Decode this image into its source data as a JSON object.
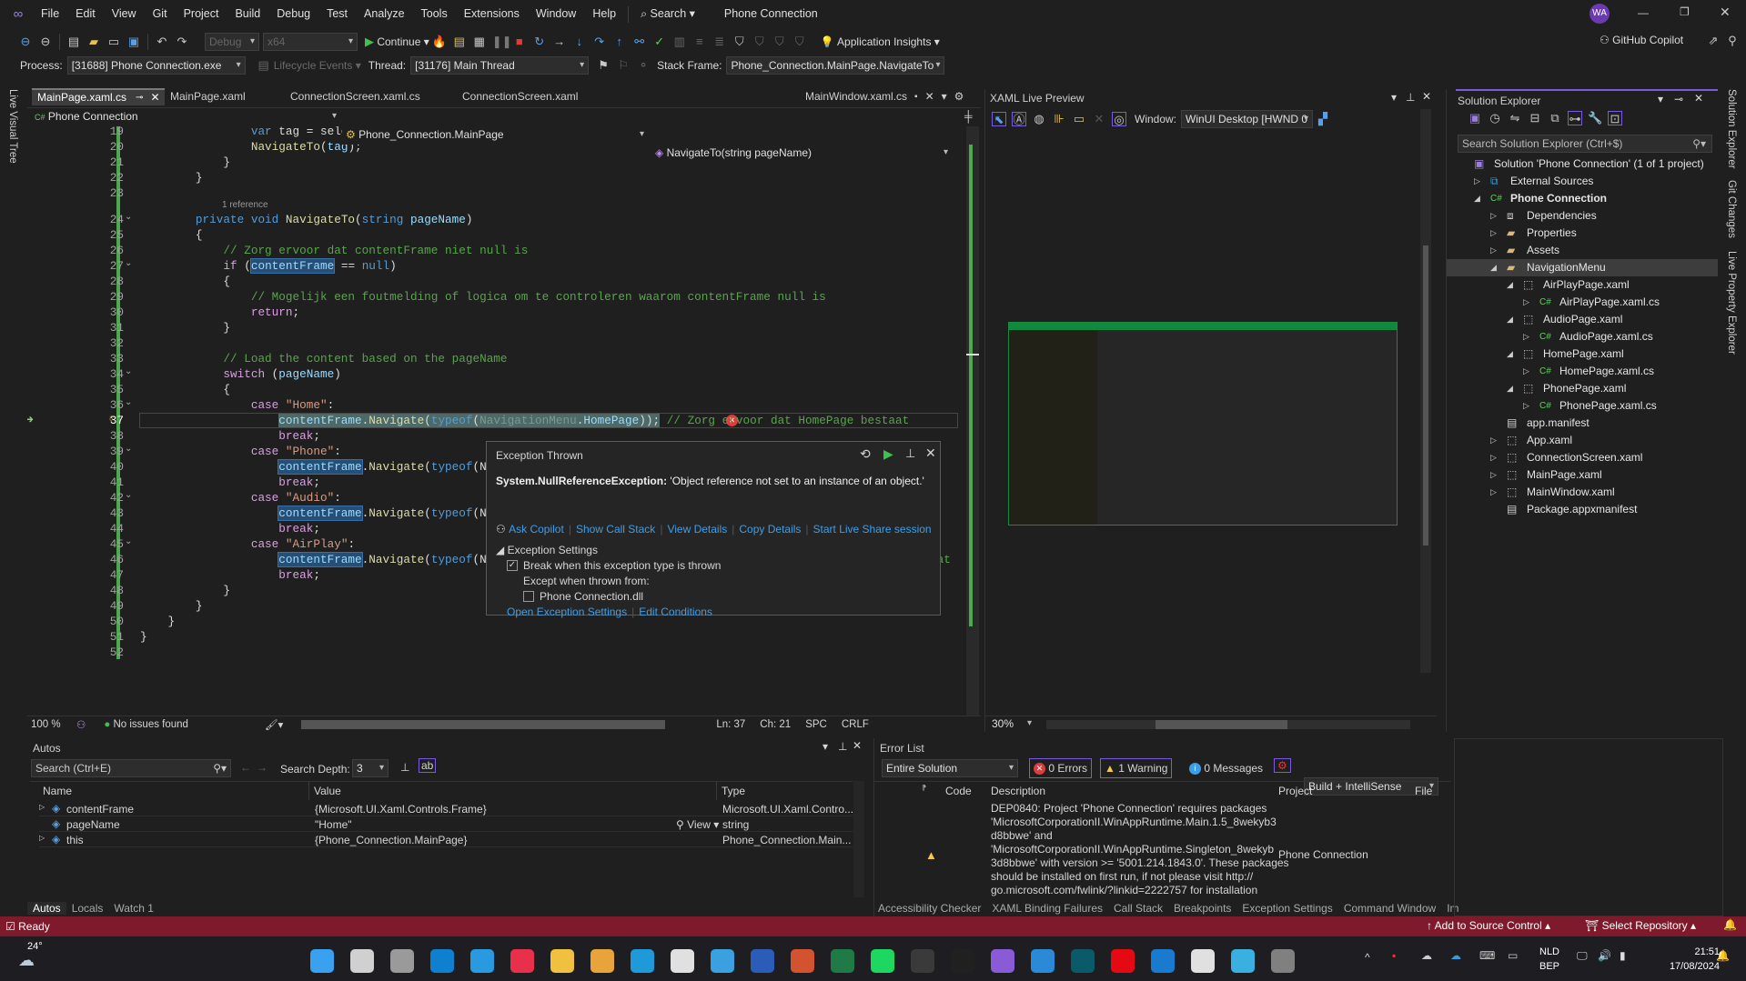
{
  "menubar": {
    "items": [
      "File",
      "Edit",
      "View",
      "Git",
      "Project",
      "Build",
      "Debug",
      "Test",
      "Analyze",
      "Tools",
      "Extensions",
      "Window",
      "Help"
    ],
    "search": "Search",
    "solution_name": "Phone Connection",
    "avatar": "WA"
  },
  "toolbar": {
    "config": "Debug",
    "platform": "x64",
    "continue": "Continue",
    "app_insights": "Application Insights",
    "copilot": "GitHub Copilot"
  },
  "debugbar": {
    "process_label": "Process:",
    "process": "[31688] Phone Connection.exe",
    "lifecycle": "Lifecycle Events",
    "thread_label": "Thread:",
    "thread": "[31176] Main Thread",
    "stack_label": "Stack Frame:",
    "stack": "Phone_Connection.MainPage.NavigateTo"
  },
  "left_strip": "Live Visual Tree",
  "right_strip": [
    "Solution Explorer",
    "Git Changes",
    "Live Property Explorer"
  ],
  "editor": {
    "tabs": [
      "MainPage.xaml.cs",
      "MainPage.xaml",
      "ConnectionScreen.xaml.cs",
      "ConnectionScreen.xaml"
    ],
    "right_tab": "MainWindow.xaml.cs",
    "nav": {
      "project": "Phone Connection",
      "class": "Phone_Connection.MainPage",
      "member": "NavigateTo(string pageName)"
    },
    "codelens": "1 reference",
    "current_line": 37,
    "lines": [
      {
        "n": 19,
        "seg": [
          [
            "d",
            "                "
          ],
          [
            "k",
            "var"
          ],
          [
            "d",
            " tag = selectedItem.Tag.ToString();"
          ]
        ]
      },
      {
        "n": 20,
        "seg": [
          [
            "d",
            "                "
          ],
          [
            "m",
            "NavigateTo"
          ],
          [
            "d",
            "("
          ],
          [
            "p",
            "tag"
          ],
          [
            "d",
            ");"
          ]
        ]
      },
      {
        "n": 21,
        "seg": [
          [
            "d",
            "            }"
          ]
        ]
      },
      {
        "n": 22,
        "seg": [
          [
            "d",
            "        }"
          ]
        ]
      },
      {
        "n": 23,
        "seg": []
      },
      {
        "n": 24,
        "seg": [
          [
            "d",
            "        "
          ],
          [
            "k",
            "private void "
          ],
          [
            "m",
            "NavigateTo"
          ],
          [
            "d",
            "("
          ],
          [
            "k",
            "string "
          ],
          [
            "p",
            "pageName"
          ],
          [
            "d",
            ")"
          ]
        ]
      },
      {
        "n": 25,
        "seg": [
          [
            "d",
            "        {"
          ]
        ]
      },
      {
        "n": 26,
        "seg": [
          [
            "d",
            "            "
          ],
          [
            "g",
            "// Zorg ervoor dat contentFrame niet null is"
          ]
        ]
      },
      {
        "n": 27,
        "seg": [
          [
            "d",
            "            "
          ],
          [
            "c",
            "if"
          ],
          [
            "d",
            " ("
          ],
          [
            "h",
            "contentFrame"
          ],
          [
            "d",
            " == "
          ],
          [
            "k",
            "null"
          ],
          [
            "d",
            ")"
          ]
        ]
      },
      {
        "n": 28,
        "seg": [
          [
            "d",
            "            {"
          ]
        ]
      },
      {
        "n": 29,
        "seg": [
          [
            "d",
            "                "
          ],
          [
            "g",
            "// Mogelijk een foutmelding of logica om te controleren waarom contentFrame null is"
          ]
        ]
      },
      {
        "n": 30,
        "seg": [
          [
            "d",
            "                "
          ],
          [
            "c",
            "return"
          ],
          [
            "d",
            ";"
          ]
        ]
      },
      {
        "n": 31,
        "seg": [
          [
            "d",
            "            }"
          ]
        ]
      },
      {
        "n": 32,
        "seg": []
      },
      {
        "n": 33,
        "seg": [
          [
            "d",
            "            "
          ],
          [
            "g",
            "// Load the content based on the pageName"
          ]
        ]
      },
      {
        "n": 34,
        "seg": [
          [
            "d",
            "            "
          ],
          [
            "c",
            "switch"
          ],
          [
            "d",
            " ("
          ],
          [
            "p",
            "pageName"
          ],
          [
            "d",
            ")"
          ]
        ]
      },
      {
        "n": 35,
        "seg": [
          [
            "d",
            "            {"
          ]
        ]
      },
      {
        "n": 36,
        "seg": [
          [
            "d",
            "                "
          ],
          [
            "c",
            "case "
          ],
          [
            "s",
            "\"Home\""
          ],
          [
            "d",
            ":"
          ]
        ]
      },
      {
        "n": 37,
        "seg": [
          [
            "d",
            "                    "
          ],
          [
            "p",
            "contentFrame"
          ],
          [
            "d",
            "."
          ],
          [
            "m",
            "Navigate"
          ],
          [
            "d",
            "("
          ],
          [
            "k",
            "typeof"
          ],
          [
            "d",
            "("
          ],
          [
            "t",
            "NavigationMenu"
          ],
          [
            "d",
            "."
          ],
          [
            "p",
            "HomePage"
          ],
          [
            "d",
            "));"
          ],
          [
            "d",
            " "
          ],
          [
            "g",
            "// Zorg ervoor dat HomePage bestaat"
          ]
        ]
      },
      {
        "n": 38,
        "seg": [
          [
            "d",
            "                    "
          ],
          [
            "c",
            "break"
          ],
          [
            "d",
            ";"
          ]
        ]
      },
      {
        "n": 39,
        "seg": [
          [
            "d",
            "                "
          ],
          [
            "c",
            "case "
          ],
          [
            "s",
            "\"Phone\""
          ],
          [
            "d",
            ":"
          ]
        ]
      },
      {
        "n": 40,
        "seg": [
          [
            "d",
            "                    "
          ],
          [
            "h",
            "contentFrame"
          ],
          [
            "d",
            "."
          ],
          [
            "m",
            "Navigate"
          ],
          [
            "d",
            "("
          ],
          [
            "k",
            "typeof"
          ],
          [
            "d",
            "(N"
          ]
        ]
      },
      {
        "n": 41,
        "seg": [
          [
            "d",
            "                    "
          ],
          [
            "c",
            "break"
          ],
          [
            "d",
            ";"
          ]
        ]
      },
      {
        "n": 42,
        "seg": [
          [
            "d",
            "                "
          ],
          [
            "c",
            "case "
          ],
          [
            "s",
            "\"Audio\""
          ],
          [
            "d",
            ":"
          ]
        ]
      },
      {
        "n": 43,
        "seg": [
          [
            "d",
            "                    "
          ],
          [
            "h",
            "contentFrame"
          ],
          [
            "d",
            "."
          ],
          [
            "m",
            "Navigate"
          ],
          [
            "d",
            "("
          ],
          [
            "k",
            "typeof"
          ],
          [
            "d",
            "(N"
          ]
        ]
      },
      {
        "n": 44,
        "seg": [
          [
            "d",
            "                    "
          ],
          [
            "c",
            "break"
          ],
          [
            "d",
            ";"
          ]
        ]
      },
      {
        "n": 45,
        "seg": [
          [
            "d",
            "                "
          ],
          [
            "c",
            "case "
          ],
          [
            "s",
            "\"AirPlay\""
          ],
          [
            "d",
            ":"
          ]
        ]
      },
      {
        "n": 46,
        "seg": [
          [
            "d",
            "                    "
          ],
          [
            "h",
            "contentFrame"
          ],
          [
            "d",
            "."
          ],
          [
            "m",
            "Navigate"
          ],
          [
            "d",
            "("
          ],
          [
            "k",
            "typeof"
          ],
          [
            "d",
            "(NavigationMenu.AirPlayPage)); "
          ],
          [
            "g",
            "// Zorg ervoor dat AirPlayPage bestaat"
          ]
        ]
      },
      {
        "n": 47,
        "seg": [
          [
            "d",
            "                    "
          ],
          [
            "c",
            "break"
          ],
          [
            "d",
            ";"
          ]
        ]
      },
      {
        "n": 48,
        "seg": [
          [
            "d",
            "            }"
          ]
        ]
      },
      {
        "n": 49,
        "seg": [
          [
            "d",
            "        }"
          ]
        ]
      },
      {
        "n": 50,
        "seg": [
          [
            "d",
            "    }"
          ]
        ]
      },
      {
        "n": 51,
        "seg": [
          [
            "d",
            "}"
          ]
        ]
      },
      {
        "n": 52,
        "seg": []
      }
    ],
    "status": {
      "zoom": "100 %",
      "issues": "No issues found",
      "ln": "Ln: 37",
      "ch": "Ch: 21",
      "spc": "SPC",
      "crlf": "CRLF"
    }
  },
  "exception": {
    "title": "Exception Thrown",
    "type": "System.NullReferenceException:",
    "message": "'Object reference not set to an instance of an object.'",
    "links": [
      "Ask Copilot",
      "Show Call Stack",
      "View Details",
      "Copy Details",
      "Start Live Share session"
    ],
    "settings_header": "Exception Settings",
    "break_when": "Break when this exception type is thrown",
    "break_checked": true,
    "except_when": "Except when thrown from:",
    "module": "Phone Connection.dll",
    "module_checked": false,
    "open_settings": "Open Exception Settings",
    "edit_conditions": "Edit Conditions"
  },
  "xaml_preview": {
    "title": "XAML Live Preview",
    "window_label": "Window:",
    "window": "WinUI Desktop [HWND 0",
    "zoom": "30%"
  },
  "solution_explorer": {
    "title": "Solution Explorer",
    "search_placeholder": "Search Solution Explorer (Ctrl+$)",
    "items": [
      {
        "label": "Solution 'Phone Connection' (1 of 1 project)",
        "level": 0,
        "exp": "",
        "icon": "solution"
      },
      {
        "label": "External Sources",
        "level": 1,
        "exp": "▷",
        "icon": "external"
      },
      {
        "label": "Phone Connection",
        "level": 1,
        "exp": "◢",
        "icon": "csproj",
        "bold": true
      },
      {
        "label": "Dependencies",
        "level": 2,
        "exp": "▷",
        "icon": "deps"
      },
      {
        "label": "Properties",
        "level": 2,
        "exp": "▷",
        "icon": "folder"
      },
      {
        "label": "Assets",
        "level": 2,
        "exp": "▷",
        "icon": "folder"
      },
      {
        "label": "NavigationMenu",
        "level": 2,
        "exp": "◢",
        "icon": "folder",
        "selected": true
      },
      {
        "label": "AirPlayPage.xaml",
        "level": 3,
        "exp": "◢",
        "icon": "xaml"
      },
      {
        "label": "AirPlayPage.xaml.cs",
        "level": 4,
        "exp": "▷",
        "icon": "cs"
      },
      {
        "label": "AudioPage.xaml",
        "level": 3,
        "exp": "◢",
        "icon": "xaml"
      },
      {
        "label": "AudioPage.xaml.cs",
        "level": 4,
        "exp": "▷",
        "icon": "cs"
      },
      {
        "label": "HomePage.xaml",
        "level": 3,
        "exp": "◢",
        "icon": "xaml"
      },
      {
        "label": "HomePage.xaml.cs",
        "level": 4,
        "exp": "▷",
        "icon": "cs"
      },
      {
        "label": "PhonePage.xaml",
        "level": 3,
        "exp": "◢",
        "icon": "xaml"
      },
      {
        "label": "PhonePage.xaml.cs",
        "level": 4,
        "exp": "▷",
        "icon": "cs"
      },
      {
        "label": "app.manifest",
        "level": 2,
        "exp": "",
        "icon": "manifest"
      },
      {
        "label": "App.xaml",
        "level": 2,
        "exp": "▷",
        "icon": "xaml"
      },
      {
        "label": "ConnectionScreen.xaml",
        "level": 2,
        "exp": "▷",
        "icon": "xaml"
      },
      {
        "label": "MainPage.xaml",
        "level": 2,
        "exp": "▷",
        "icon": "xaml"
      },
      {
        "label": "MainWindow.xaml",
        "level": 2,
        "exp": "▷",
        "icon": "xaml"
      },
      {
        "label": "Package.appxmanifest",
        "level": 2,
        "exp": "",
        "icon": "manifest"
      }
    ]
  },
  "autos": {
    "title": "Autos",
    "search_placeholder": "Search (Ctrl+E)",
    "depth_label": "Search Depth:",
    "depth": "3",
    "columns": [
      "Name",
      "Value",
      "Type"
    ],
    "rows": [
      {
        "name": "contentFrame",
        "value": "{Microsoft.UI.Xaml.Controls.Frame}",
        "type": "Microsoft.UI.Xaml.Contro...",
        "expandable": true
      },
      {
        "name": "pageName",
        "value": "\"Home\"",
        "type": "string",
        "view": "View"
      },
      {
        "name": "this",
        "value": "{Phone_Connection.MainPage}",
        "type": "Phone_Connection.Main...",
        "expandable": true
      }
    ],
    "tabs": [
      "Autos",
      "Locals",
      "Watch 1"
    ]
  },
  "error_list": {
    "title": "Error List",
    "scope": "Entire Solution",
    "errors": "0 Errors",
    "warnings": "1 Warning",
    "messages": "0 Messages",
    "source": "Build + IntelliSense",
    "columns": [
      "Code",
      "Description",
      "Project",
      "File"
    ],
    "row": {
      "description": [
        "DEP0840: Project 'Phone Connection' requires packages",
        "'MicrosoftCorporationII.WinAppRuntime.Main.1.5_8wekyb3",
        "d8bbwe' and",
        "'MicrosoftCorporationII.WinAppRuntime.Singleton_8wekyb",
        "3d8bbwe' with version >= '5001.214.1843.0'. These packages",
        "should be installed on first run, if not please visit http://",
        "go.microsoft.com/fwlink/?linkid=2222757 for installation"
      ],
      "project": "Phone Connection"
    },
    "tabs": [
      "Accessibility Checker",
      "XAML Binding Failures",
      "Call Stack",
      "Breakpoints",
      "Exception Settings",
      "Command Window",
      "Im"
    ]
  },
  "statusbar": {
    "ready": "Ready",
    "source_control": "Add to Source Control",
    "repository": "Select Repository",
    "color": "#7e1a2b"
  },
  "taskbar": {
    "weather": "24°",
    "lang1": "NLD",
    "lang2": "BEP",
    "time": "21:51",
    "date": "17/08/2024",
    "apps": [
      {
        "name": "start",
        "color": "#3aa0f0"
      },
      {
        "name": "search",
        "color": "#d0d0d0"
      },
      {
        "name": "task-view",
        "color": "#9a9a9a"
      },
      {
        "name": "myhp",
        "color": "#0f7fd0"
      },
      {
        "name": "help",
        "color": "#2a9ae0"
      },
      {
        "name": "app-red",
        "color": "#e8304a"
      },
      {
        "name": "file-explorer",
        "color": "#f0c040"
      },
      {
        "name": "chrome",
        "color": "#e8a33a"
      },
      {
        "name": "edge",
        "color": "#1f9ad8"
      },
      {
        "name": "store",
        "color": "#e0e0e0"
      },
      {
        "name": "mail",
        "color": "#3aa0e0"
      },
      {
        "name": "word",
        "color": "#2b5db8"
      },
      {
        "name": "powerpoint",
        "color": "#d35230"
      },
      {
        "name": "excel",
        "color": "#1f7a45"
      },
      {
        "name": "spotify",
        "color": "#1ed760"
      },
      {
        "name": "app-dark",
        "color": "#3a3a3a"
      },
      {
        "name": "epic-games",
        "color": "#202020"
      },
      {
        "name": "visual-studio",
        "color": "#8a5bd6"
      },
      {
        "name": "vscode",
        "color": "#2a8ad8"
      },
      {
        "name": "disney-plus",
        "color": "#0a5a6a"
      },
      {
        "name": "netflix",
        "color": "#e50914"
      },
      {
        "name": "dev-tools",
        "color": "#1a7ad0"
      },
      {
        "name": "paint",
        "color": "#e0e0e0"
      },
      {
        "name": "paint3d",
        "color": "#3ab0e0"
      },
      {
        "name": "snipping",
        "color": "#808080"
      }
    ]
  }
}
